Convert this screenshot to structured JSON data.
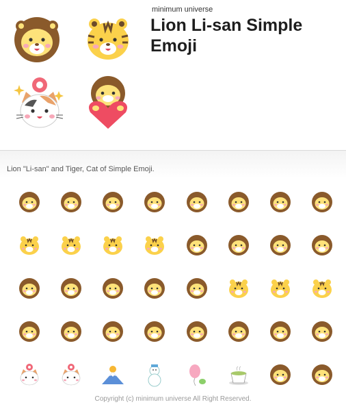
{
  "header": {
    "author": "minimum universe",
    "title": "Lion Li-san Simple Emoji"
  },
  "hero_icons": [
    "lion-face-icon",
    "tiger-face-icon",
    "cat-with-donut-icon",
    "lion-holding-heart-icon"
  ],
  "description": "Lion \"Li-san\" and Tiger, Cat of Simple Emoji.",
  "stickers": [
    [
      "lion",
      "lion",
      "lion",
      "lion",
      "lion",
      "lion",
      "lion",
      "lion"
    ],
    [
      "tiger",
      "tiger",
      "tiger",
      "tiger",
      "lion",
      "lion",
      "lion",
      "lion"
    ],
    [
      "lion",
      "lion",
      "lion",
      "lion",
      "lion",
      "tiger",
      "tiger",
      "tiger"
    ],
    [
      "lion",
      "lion",
      "lion",
      "lion",
      "lion",
      "lion",
      "lion",
      "lion"
    ],
    [
      "cat",
      "cat",
      "mountain",
      "snowman",
      "balloon",
      "cup",
      "lion",
      "lion"
    ]
  ],
  "footer": {
    "copyright": "Copyright (c) minimum universe All Right Reserved."
  },
  "colors": {
    "mane": "#8a5a2b",
    "face": "#fde27a",
    "cheek": "#f7a8b8",
    "heart": "#ee4c62",
    "donut": "#f06878"
  }
}
